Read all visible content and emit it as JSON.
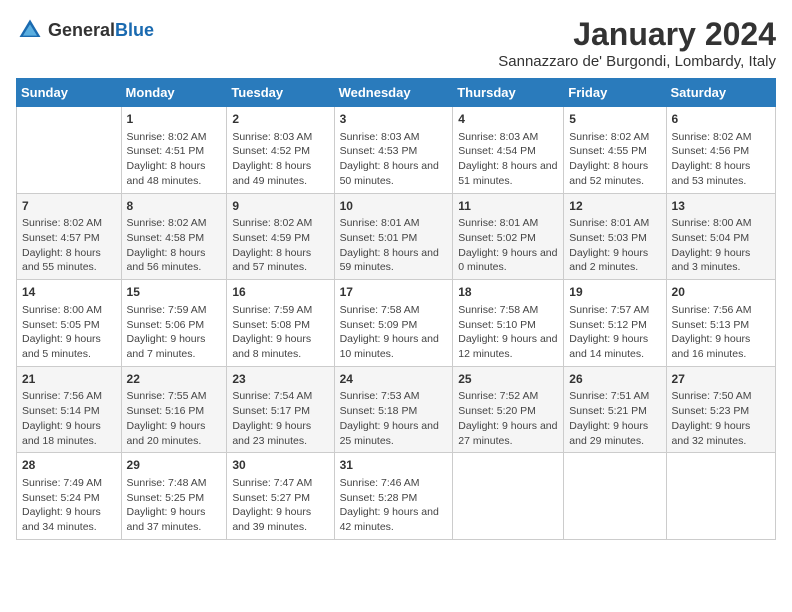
{
  "header": {
    "logo_general": "General",
    "logo_blue": "Blue",
    "title": "January 2024",
    "subtitle": "Sannazzaro de' Burgondi, Lombardy, Italy"
  },
  "days_of_week": [
    "Sunday",
    "Monday",
    "Tuesday",
    "Wednesday",
    "Thursday",
    "Friday",
    "Saturday"
  ],
  "weeks": [
    [
      {
        "day": "",
        "data": ""
      },
      {
        "day": "1",
        "data": "Sunrise: 8:02 AM\nSunset: 4:51 PM\nDaylight: 8 hours and 48 minutes."
      },
      {
        "day": "2",
        "data": "Sunrise: 8:03 AM\nSunset: 4:52 PM\nDaylight: 8 hours and 49 minutes."
      },
      {
        "day": "3",
        "data": "Sunrise: 8:03 AM\nSunset: 4:53 PM\nDaylight: 8 hours and 50 minutes."
      },
      {
        "day": "4",
        "data": "Sunrise: 8:03 AM\nSunset: 4:54 PM\nDaylight: 8 hours and 51 minutes."
      },
      {
        "day": "5",
        "data": "Sunrise: 8:02 AM\nSunset: 4:55 PM\nDaylight: 8 hours and 52 minutes."
      },
      {
        "day": "6",
        "data": "Sunrise: 8:02 AM\nSunset: 4:56 PM\nDaylight: 8 hours and 53 minutes."
      }
    ],
    [
      {
        "day": "7",
        "data": "Sunrise: 8:02 AM\nSunset: 4:57 PM\nDaylight: 8 hours and 55 minutes."
      },
      {
        "day": "8",
        "data": "Sunrise: 8:02 AM\nSunset: 4:58 PM\nDaylight: 8 hours and 56 minutes."
      },
      {
        "day": "9",
        "data": "Sunrise: 8:02 AM\nSunset: 4:59 PM\nDaylight: 8 hours and 57 minutes."
      },
      {
        "day": "10",
        "data": "Sunrise: 8:01 AM\nSunset: 5:01 PM\nDaylight: 8 hours and 59 minutes."
      },
      {
        "day": "11",
        "data": "Sunrise: 8:01 AM\nSunset: 5:02 PM\nDaylight: 9 hours and 0 minutes."
      },
      {
        "day": "12",
        "data": "Sunrise: 8:01 AM\nSunset: 5:03 PM\nDaylight: 9 hours and 2 minutes."
      },
      {
        "day": "13",
        "data": "Sunrise: 8:00 AM\nSunset: 5:04 PM\nDaylight: 9 hours and 3 minutes."
      }
    ],
    [
      {
        "day": "14",
        "data": "Sunrise: 8:00 AM\nSunset: 5:05 PM\nDaylight: 9 hours and 5 minutes."
      },
      {
        "day": "15",
        "data": "Sunrise: 7:59 AM\nSunset: 5:06 PM\nDaylight: 9 hours and 7 minutes."
      },
      {
        "day": "16",
        "data": "Sunrise: 7:59 AM\nSunset: 5:08 PM\nDaylight: 9 hours and 8 minutes."
      },
      {
        "day": "17",
        "data": "Sunrise: 7:58 AM\nSunset: 5:09 PM\nDaylight: 9 hours and 10 minutes."
      },
      {
        "day": "18",
        "data": "Sunrise: 7:58 AM\nSunset: 5:10 PM\nDaylight: 9 hours and 12 minutes."
      },
      {
        "day": "19",
        "data": "Sunrise: 7:57 AM\nSunset: 5:12 PM\nDaylight: 9 hours and 14 minutes."
      },
      {
        "day": "20",
        "data": "Sunrise: 7:56 AM\nSunset: 5:13 PM\nDaylight: 9 hours and 16 minutes."
      }
    ],
    [
      {
        "day": "21",
        "data": "Sunrise: 7:56 AM\nSunset: 5:14 PM\nDaylight: 9 hours and 18 minutes."
      },
      {
        "day": "22",
        "data": "Sunrise: 7:55 AM\nSunset: 5:16 PM\nDaylight: 9 hours and 20 minutes."
      },
      {
        "day": "23",
        "data": "Sunrise: 7:54 AM\nSunset: 5:17 PM\nDaylight: 9 hours and 23 minutes."
      },
      {
        "day": "24",
        "data": "Sunrise: 7:53 AM\nSunset: 5:18 PM\nDaylight: 9 hours and 25 minutes."
      },
      {
        "day": "25",
        "data": "Sunrise: 7:52 AM\nSunset: 5:20 PM\nDaylight: 9 hours and 27 minutes."
      },
      {
        "day": "26",
        "data": "Sunrise: 7:51 AM\nSunset: 5:21 PM\nDaylight: 9 hours and 29 minutes."
      },
      {
        "day": "27",
        "data": "Sunrise: 7:50 AM\nSunset: 5:23 PM\nDaylight: 9 hours and 32 minutes."
      }
    ],
    [
      {
        "day": "28",
        "data": "Sunrise: 7:49 AM\nSunset: 5:24 PM\nDaylight: 9 hours and 34 minutes."
      },
      {
        "day": "29",
        "data": "Sunrise: 7:48 AM\nSunset: 5:25 PM\nDaylight: 9 hours and 37 minutes."
      },
      {
        "day": "30",
        "data": "Sunrise: 7:47 AM\nSunset: 5:27 PM\nDaylight: 9 hours and 39 minutes."
      },
      {
        "day": "31",
        "data": "Sunrise: 7:46 AM\nSunset: 5:28 PM\nDaylight: 9 hours and 42 minutes."
      },
      {
        "day": "",
        "data": ""
      },
      {
        "day": "",
        "data": ""
      },
      {
        "day": "",
        "data": ""
      }
    ]
  ]
}
